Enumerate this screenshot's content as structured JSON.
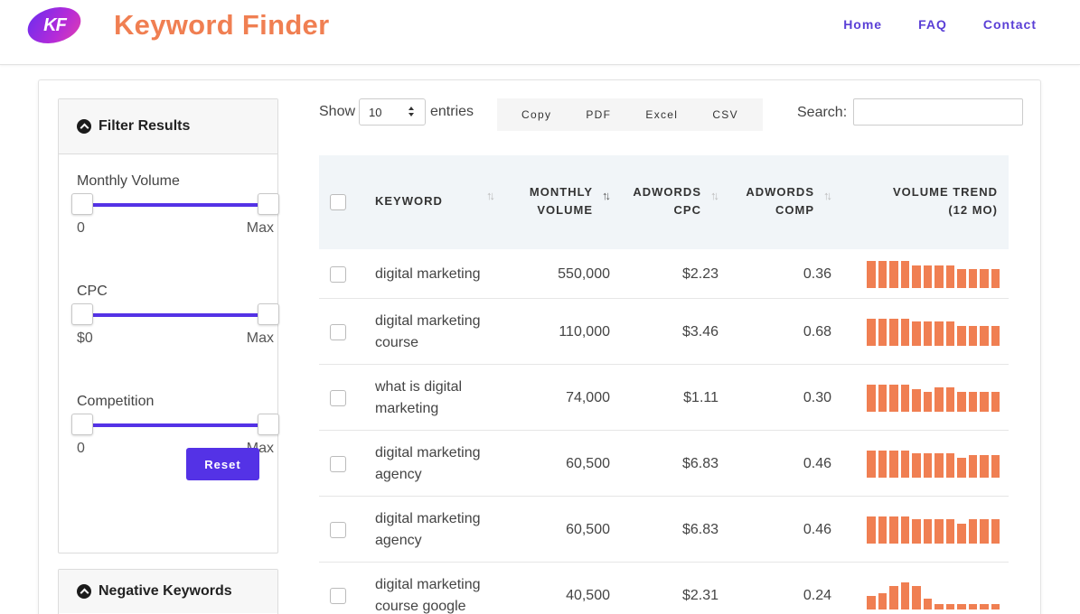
{
  "header": {
    "logo_text": "KF",
    "title": "Keyword Finder",
    "nav": [
      "Home",
      "FAQ",
      "Contact"
    ]
  },
  "filters": {
    "title": "Filter Results",
    "groups": [
      {
        "label": "Monthly Volume",
        "min": "0",
        "max": "Max"
      },
      {
        "label": "CPC",
        "min": "$0",
        "max": "Max"
      },
      {
        "label": "Competition",
        "min": "0",
        "max": "Max"
      }
    ],
    "reset_label": "Reset"
  },
  "negative_keywords": {
    "title": "Negative Keywords"
  },
  "controls": {
    "show_label": "Show",
    "page_size": "10",
    "entries_label": "entries",
    "export_buttons": [
      "Copy",
      "PDF",
      "Excel",
      "CSV"
    ],
    "search_label": "Search:",
    "search_value": ""
  },
  "table": {
    "headers": {
      "keyword": "KEYWORD",
      "volume": [
        "MONTHLY",
        "VOLUME"
      ],
      "cpc": [
        "ADWORDS",
        "CPC"
      ],
      "comp": [
        "ADWORDS",
        "COMP"
      ],
      "trend": [
        "VOLUME TREND",
        "(12 MO)"
      ]
    },
    "rows": [
      {
        "keyword": [
          "digital marketing"
        ],
        "volume": "550,000",
        "cpc": "$2.23",
        "comp": "0.36",
        "trend": [
          1,
          1,
          1,
          1,
          0.83,
          0.83,
          0.83,
          0.83,
          0.7,
          0.7,
          0.7,
          0.7
        ]
      },
      {
        "keyword": [
          "digital marketing",
          "course"
        ],
        "volume": "110,000",
        "cpc": "$3.46",
        "comp": "0.68",
        "trend": [
          1,
          1,
          1,
          1,
          0.87,
          0.87,
          0.87,
          0.87,
          0.73,
          0.73,
          0.73,
          0.73
        ]
      },
      {
        "keyword": [
          "what is digital",
          "marketing"
        ],
        "volume": "74,000",
        "cpc": "$1.11",
        "comp": "0.30",
        "trend": [
          1,
          1,
          1,
          1,
          0.83,
          0.73,
          0.9,
          0.9,
          0.73,
          0.73,
          0.73,
          0.73
        ]
      },
      {
        "keyword": [
          "digital marketing",
          "agency"
        ],
        "volume": "60,500",
        "cpc": "$6.83",
        "comp": "0.46",
        "trend": [
          1,
          1,
          1,
          1,
          0.9,
          0.9,
          0.9,
          0.9,
          0.73,
          0.83,
          0.83,
          0.83
        ]
      },
      {
        "keyword": [
          "digital marketing",
          "agency"
        ],
        "volume": "60,500",
        "cpc": "$6.83",
        "comp": "0.46",
        "trend": [
          1,
          1,
          1,
          1,
          0.87,
          0.87,
          0.87,
          0.87,
          0.73,
          0.87,
          0.87,
          0.87
        ]
      },
      {
        "keyword": [
          "digital marketing",
          "course google"
        ],
        "volume": "40,500",
        "cpc": "$2.31",
        "comp": "0.24",
        "trend": [
          0.5,
          0.6,
          0.85,
          1,
          0.85,
          0.4,
          0.2,
          0.2,
          0.2,
          0.2,
          0.2,
          0.2
        ]
      }
    ]
  }
}
